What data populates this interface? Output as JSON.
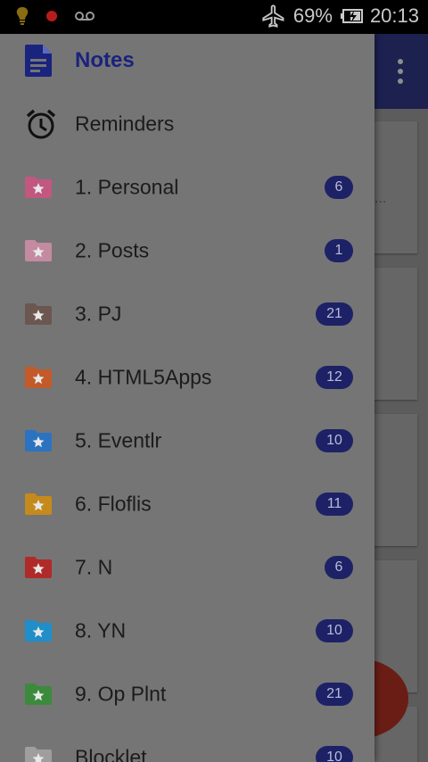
{
  "status_bar": {
    "battery_percent": "69%",
    "time": "20:13",
    "icons": [
      "bulb-icon",
      "record-dot-icon",
      "voicemail-icon",
      "airplane-mode-icon",
      "battery-charging-icon"
    ]
  },
  "drawer": {
    "items": [
      {
        "label": "Notes",
        "icon": "notes-icon",
        "active": true
      },
      {
        "label": "Reminders",
        "icon": "alarm-clock-icon"
      },
      {
        "label": "1. Personal",
        "count": "6",
        "color": "#c2577f"
      },
      {
        "label": "2. Posts",
        "count": "1",
        "color": "#c48aa0"
      },
      {
        "label": "3. PJ",
        "count": "21",
        "color": "#6b5650"
      },
      {
        "label": "4. HTML5Apps",
        "count": "12",
        "color": "#c25a2a"
      },
      {
        "label": "5. Eventlr",
        "count": "10",
        "color": "#2b73c0"
      },
      {
        "label": "6. Floflis",
        "count": "11",
        "color": "#c58a1c"
      },
      {
        "label": "7. N",
        "count": "6",
        "color": "#b02a2a"
      },
      {
        "label": "8. YN",
        "count": "10",
        "color": "#1f8ec9"
      },
      {
        "label": "9. Op Plnt",
        "count": "21",
        "color": "#3c8a3c"
      },
      {
        "label": "Blocklet",
        "count": "10",
        "color": "#9e9e9e"
      }
    ]
  },
  "colors": {
    "accent": "#1a237e",
    "badge_bg": "#1d2266",
    "drawer_bg": "#757575",
    "fab": "#6a1d15"
  }
}
